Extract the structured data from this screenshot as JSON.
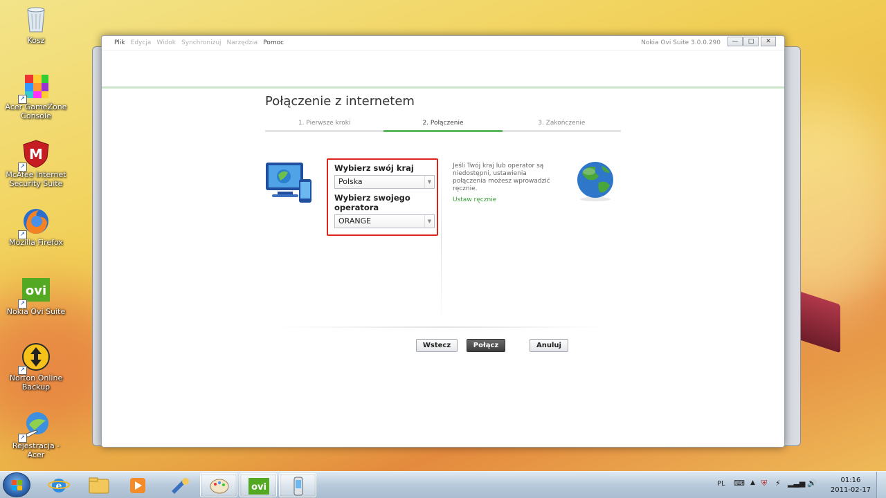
{
  "desktop": {
    "icons": [
      {
        "label": "Kosz",
        "icon": "recycle-bin-icon"
      },
      {
        "label": "Acer GameZone Console",
        "icon": "gamezone-icon"
      },
      {
        "label": "McAfee Internet Security Suite",
        "icon": "mcafee-icon"
      },
      {
        "label": "Mozilla Firefox",
        "icon": "firefox-icon"
      },
      {
        "label": "Nokia Ovi Suite",
        "icon": "ovi-icon"
      },
      {
        "label": "Norton Online Backup",
        "icon": "norton-icon"
      },
      {
        "label": "Rejestracja - Acer",
        "icon": "acer-registration-icon"
      }
    ]
  },
  "window": {
    "title": "Nokia Ovi Suite 3.0.0.290",
    "menu": [
      "Plik",
      "Edycja",
      "Widok",
      "Synchronizuj",
      "Narzędzia",
      "Pomoc"
    ],
    "controls": {
      "minimize": "—",
      "maximize": "□",
      "close": "✕"
    }
  },
  "dialog": {
    "title": "Połączenie z internetem",
    "steps": [
      "1. Pierwsze kroki",
      "2. Połączenie",
      "3. Zakończenie"
    ],
    "active_step": 1,
    "country": {
      "label": "Wybierz swój kraj",
      "value": "Polska"
    },
    "operator": {
      "label": "Wybierz swojego operatora",
      "value": "ORANGE"
    },
    "info": {
      "text": "Jeśli Twój kraj lub operator są niedostępni, ustawienia połączenia możesz wprowadzić ręcznie.",
      "link": "Ustaw ręcznie"
    },
    "buttons": {
      "back": "Wstecz",
      "connect": "Połącz",
      "cancel": "Anuluj"
    }
  },
  "taskbar": {
    "language": "PL",
    "time": "01:16",
    "date": "2011-02-17",
    "apps": [
      "explorer-icon",
      "internet-explorer-icon",
      "file-manager-icon",
      "media-player-icon",
      "tools-icon",
      "paint-icon",
      "ovi-icon",
      "phone-icon"
    ]
  },
  "colors": {
    "accent_green": "#5cb85c",
    "highlight_red": "#d9231d",
    "link_green": "#3aa03a"
  }
}
